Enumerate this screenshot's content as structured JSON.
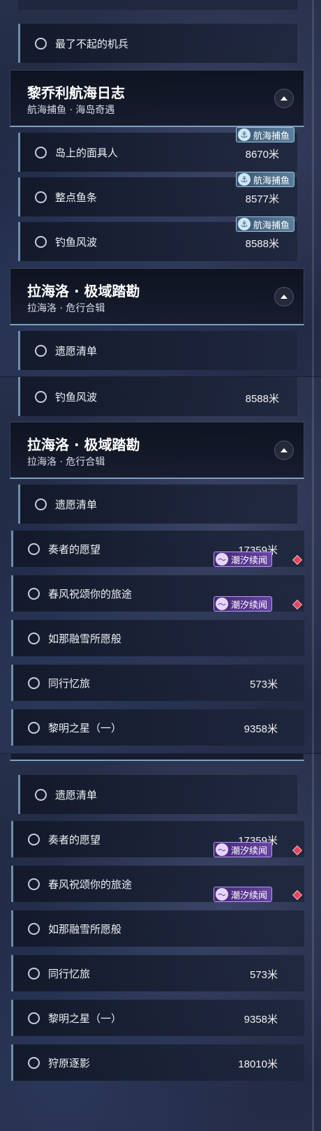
{
  "labels": {
    "last_mech": "最了不起的机兵",
    "island_mask": "岛上的面具人",
    "hour_fish": "整点鱼条",
    "fishing_storm": "钓鱼风波",
    "wish_list": "遗愿清单",
    "player_wish": "奏者的愿望",
    "spring_wind": "春风祝颂你的旅途",
    "melting_snow": "如那融雪所愿般",
    "travel_memory": "同行忆旅",
    "dawn_star": "黎明之星（一）",
    "hunt_shadow": "狩原逐影"
  },
  "distances": {
    "island_mask": "8670米",
    "hour_fish": "8577米",
    "fishing_storm": "8588米",
    "player_wish": "17359米",
    "travel_memory": "573米",
    "dawn_star": "9358米",
    "hunt_shadow": "18010米"
  },
  "groups": {
    "lichore": {
      "title": "黎乔利航海日志",
      "subtitle": "航海捕鱼 · 海岛奇遇"
    },
    "lahailuo": {
      "title": "拉海洛 · 极域踏勘",
      "subtitle": "拉海洛 · 危行合辑"
    }
  },
  "tags": {
    "fishing": "航海捕鱼",
    "tide": "潮汐续闻"
  },
  "colors": {
    "accent_line": "#7fa0c0",
    "fishing_tag": "#9cc6e0",
    "tide_tag": "#b796ff",
    "alert_diamond": "#e0475e"
  },
  "icons": {
    "radio": "radio-circle-icon",
    "collapse": "chevron-up-icon",
    "fishing_tag": "fish-hook-icon",
    "tide_tag": "wave-icon",
    "alert": "red-diamond-icon"
  }
}
